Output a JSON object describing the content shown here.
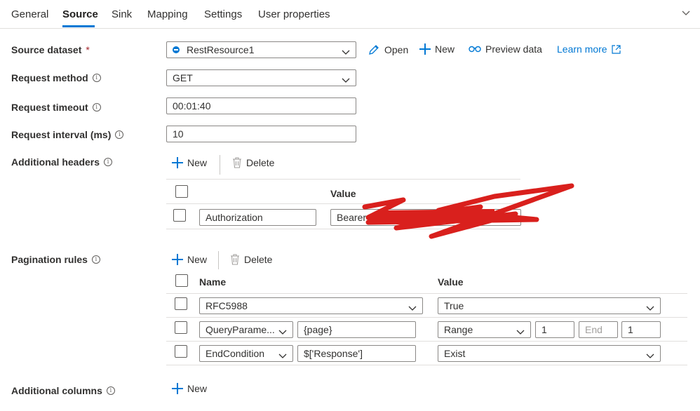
{
  "tabs": [
    {
      "label": "General"
    },
    {
      "label": "Source"
    },
    {
      "label": "Sink"
    },
    {
      "label": "Mapping"
    },
    {
      "label": "Settings"
    },
    {
      "label": "User properties"
    }
  ],
  "active_tab": "Source",
  "accent_color": "#0078d4",
  "source_dataset": {
    "label": "Source dataset",
    "required_marker": "*",
    "value": "RestResource1",
    "actions": {
      "open": "Open",
      "new": "New",
      "preview": "Preview data",
      "learn_more": "Learn more"
    }
  },
  "request_method": {
    "label": "Request method",
    "value": "GET"
  },
  "request_timeout": {
    "label": "Request timeout",
    "value": "00:01:40"
  },
  "request_interval": {
    "label": "Request interval (ms)",
    "value": "10"
  },
  "additional_headers": {
    "label": "Additional headers",
    "new_label": "New",
    "delete_label": "Delete",
    "value_header": "Value",
    "rows": [
      {
        "name": "Authorization",
        "value": "Bearer"
      }
    ],
    "redaction_note": "value obscured by red scribble"
  },
  "pagination_rules": {
    "label": "Pagination rules",
    "new_label": "New",
    "delete_label": "Delete",
    "name_header": "Name",
    "value_header": "Value",
    "rows": [
      {
        "name": "RFC5988",
        "value": "True"
      },
      {
        "name": "QueryParame...",
        "param": "{page}",
        "value": "Range",
        "start": "1",
        "end_placeholder": "End",
        "step": "1"
      },
      {
        "name": "EndCondition",
        "param": "$['Response']",
        "value": "Exist"
      }
    ]
  },
  "additional_columns": {
    "label": "Additional columns",
    "new_label": "New"
  }
}
